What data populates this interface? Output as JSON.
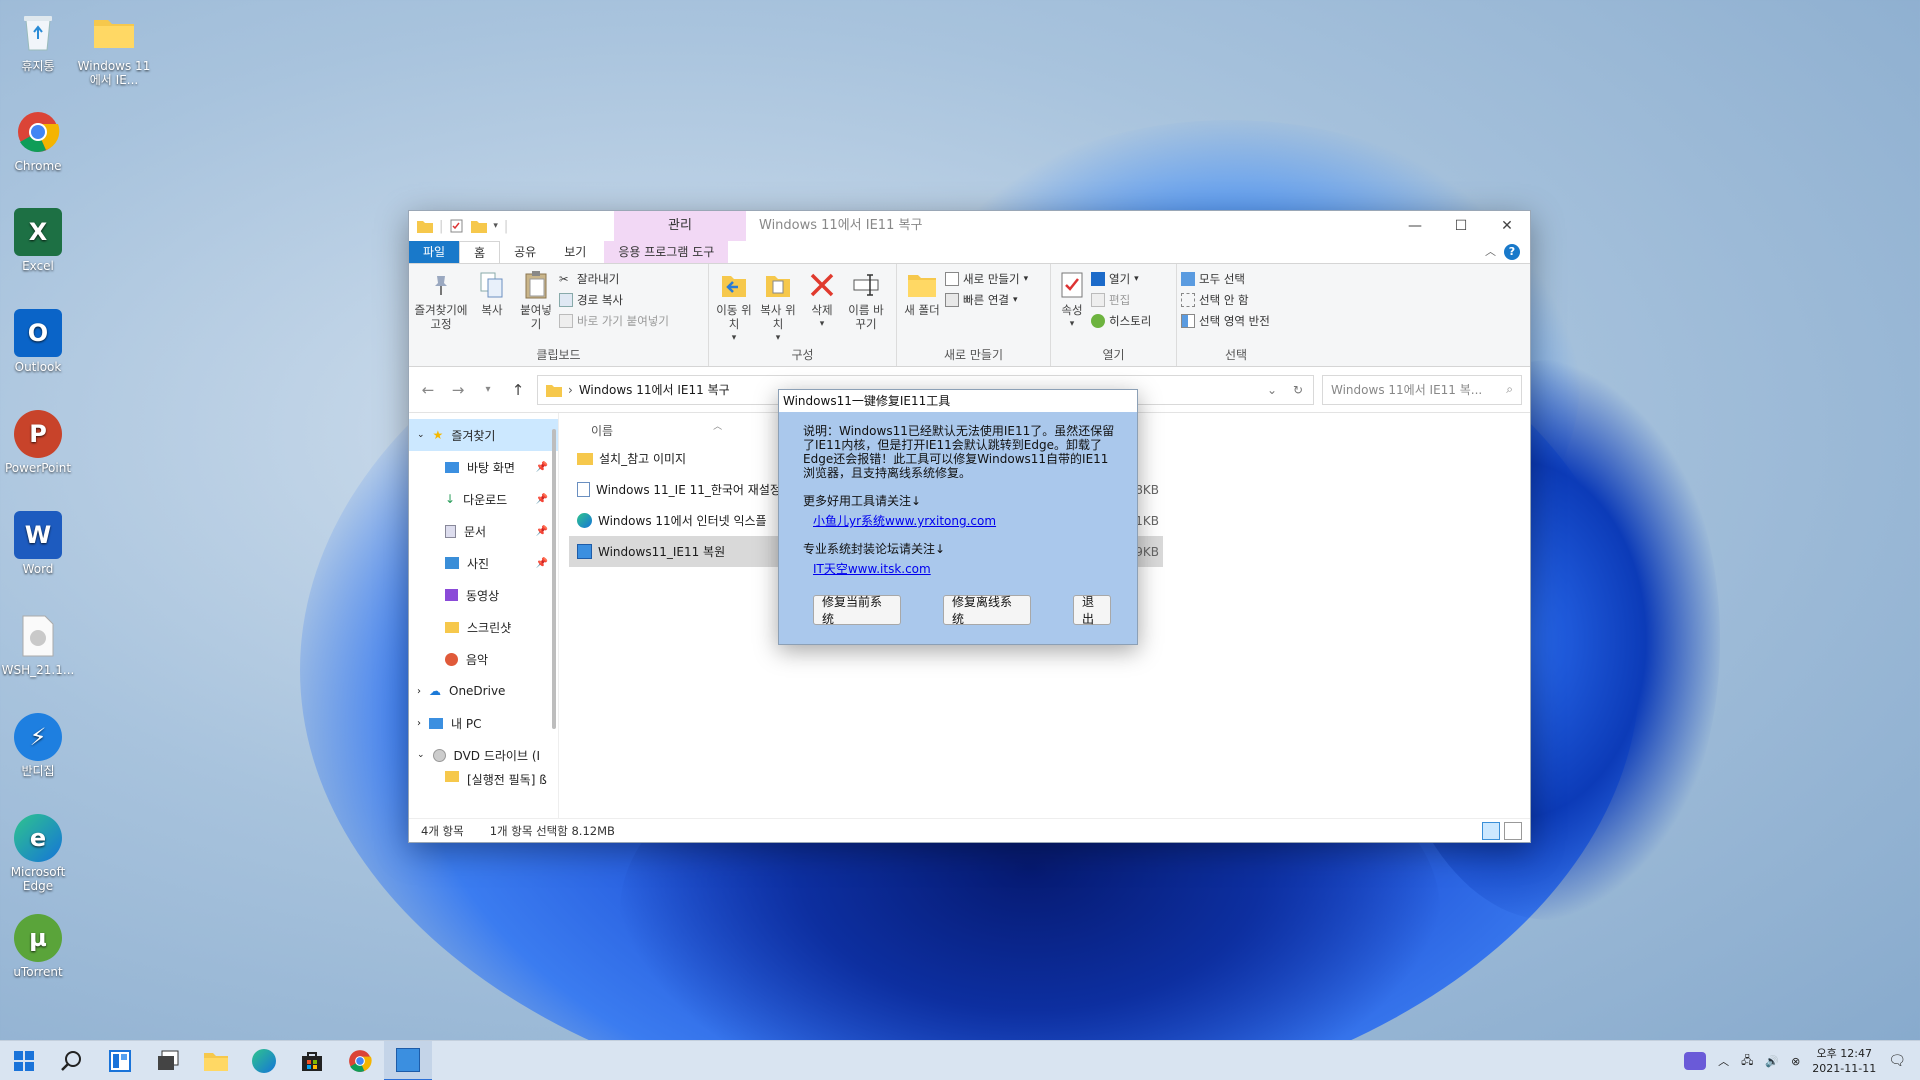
{
  "desktop": {
    "icons": [
      {
        "label": "휴지통",
        "icon": "recycle-bin-icon"
      },
      {
        "label": "Windows 11에서 IE...",
        "icon": "folder-icon"
      },
      {
        "label": "Chrome",
        "icon": "chrome-icon"
      },
      {
        "label": "Excel",
        "icon": "excel-icon"
      },
      {
        "label": "Outlook",
        "icon": "outlook-icon"
      },
      {
        "label": "PowerPoint",
        "icon": "powerpoint-icon"
      },
      {
        "label": "Word",
        "icon": "word-icon"
      },
      {
        "label": "WSH_21.1...",
        "icon": "file-icon"
      },
      {
        "label": "반디집",
        "icon": "bandizip-icon"
      },
      {
        "label": "Microsoft Edge",
        "icon": "edge-icon"
      },
      {
        "label": "uTorrent",
        "icon": "utorrent-icon"
      }
    ]
  },
  "explorer": {
    "title": "Windows 11에서 IE11 복구",
    "manage_tab": "관리",
    "tabs": {
      "file": "파일",
      "home": "홈",
      "share": "공유",
      "view": "보기",
      "app_tools": "응용 프로그램 도구"
    },
    "ribbon": {
      "clipboard": {
        "label": "클립보드",
        "pin": "즐겨찾기에 고정",
        "copy": "복사",
        "paste": "붙여넣기",
        "cut": "잘라내기",
        "copy_path": "경로 복사",
        "paste_shortcut": "바로 가기 붙여넣기"
      },
      "organize": {
        "label": "구성",
        "move_to": "이동 위치",
        "copy_to": "복사 위치",
        "delete": "삭제",
        "rename": "이름 바꾸기"
      },
      "new": {
        "label": "새로 만들기",
        "new_folder": "새 폴더",
        "new_item": "새로 만들기",
        "easy_access": "빠른 연결"
      },
      "open": {
        "label": "열기",
        "properties": "속성",
        "open": "열기",
        "edit": "편집",
        "history": "히스토리"
      },
      "select": {
        "label": "선택",
        "select_all": "모두 선택",
        "select_none": "선택 안 함",
        "invert": "선택 영역 반전"
      }
    },
    "address": {
      "path": "Windows 11에서 IE11 복구",
      "search_placeholder": "Windows 11에서 IE11 복..."
    },
    "nav": {
      "quick_access": "즐겨찾기",
      "items": [
        {
          "label": "바탕 화면",
          "icon": "desktop-icon"
        },
        {
          "label": "다운로드",
          "icon": "download-icon"
        },
        {
          "label": "문서",
          "icon": "documents-icon"
        },
        {
          "label": "사진",
          "icon": "pictures-icon"
        },
        {
          "label": "동영상",
          "icon": "videos-icon"
        },
        {
          "label": "스크린샷",
          "icon": "folder-icon"
        },
        {
          "label": "음악",
          "icon": "music-icon"
        }
      ],
      "onedrive": "OneDrive",
      "this_pc": "내 PC",
      "dvd": "DVD 드라이브 (I",
      "partial": "[실행전 필독] ß"
    },
    "list": {
      "col_name": "이름",
      "files": [
        {
          "name": "설치_참고 이미지",
          "size": "",
          "icon": "folder-icon"
        },
        {
          "name": "Windows 11_IE 11_한국어 재설정",
          "size": "8KB",
          "icon": "registry-file-icon"
        },
        {
          "name": "Windows 11에서 인터넷 익스플",
          "size": "1KB",
          "icon": "ie-shortcut-icon"
        },
        {
          "name": "Windows11_IE11 복원",
          "size": "8,319KB",
          "icon": "exe-icon"
        }
      ]
    },
    "status": {
      "count": "4개 항목",
      "selected": "1개 항목 선택함 8.12MB"
    }
  },
  "dialog": {
    "title": "Windows11一键修复IE11工具",
    "desc": "说明：Windows11已经默认无法使用IE11了。虽然还保留了IE11内核，但是打开IE11会默认跳转到Edge。卸载了Edge还会报错！此工具可以修复Windows11自带的IE11浏览器，且支持离线系统修复。",
    "sect1": "更多好用工具请关注↓",
    "link1": "小鱼儿yr系统www.yrxitong.com",
    "sect2": "专业系统封装论坛请关注↓",
    "link2": "IT天空www.itsk.com",
    "btn_current": "修复当前系统",
    "btn_offline": "修复离线系统",
    "btn_exit": "退出"
  },
  "taskbar": {
    "time": "오후 12:47",
    "date": "2021-11-11"
  },
  "colors": {
    "accent": "#1979ca",
    "manage_tab": "#f2d8f5",
    "dialog_bg": "#aac8ec",
    "taskbar": "#d9e4f1"
  }
}
